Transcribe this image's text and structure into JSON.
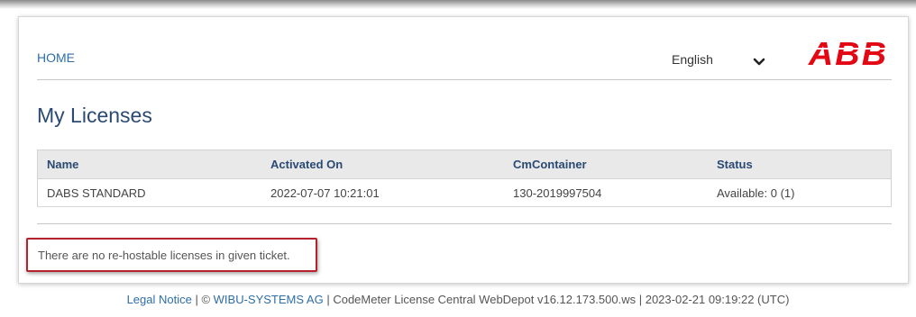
{
  "header": {
    "home_label": "HOME",
    "language": "English",
    "logo_text": "ABB"
  },
  "main": {
    "title": "My Licenses",
    "table": {
      "columns": [
        "Name",
        "Activated On",
        "CmContainer",
        "Status"
      ],
      "rows": [
        [
          "DABS STANDARD",
          "2022-07-07 10:21:01",
          "130-2019997504",
          "Available: 0 (1)"
        ]
      ]
    },
    "notice": "There are no re-hostable licenses in given ticket."
  },
  "footer": {
    "legal_notice": "Legal Notice",
    "sep1": " | © ",
    "company": "WIBU-SYSTEMS AG",
    "info": " | CodeMeter License Central WebDepot v16.12.173.500.ws | 2023-02-21 09:19:22 (UTC)"
  },
  "colors": {
    "brand_red": "#e30613",
    "link_blue": "#2d6ea8",
    "heading_blue": "#2a4a73",
    "highlight_border": "#b5222b"
  },
  "icons": {
    "language_dropdown": "chevron-down-icon"
  }
}
